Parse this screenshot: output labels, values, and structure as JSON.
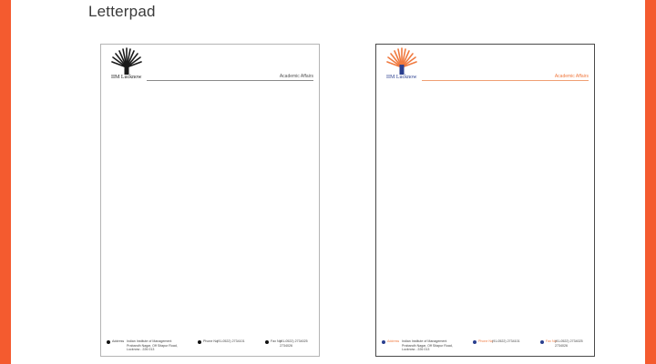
{
  "page": {
    "title": "Letterpad"
  },
  "colors": {
    "accent": "#f45b2f",
    "mono_ink": "#1a1a1a",
    "brand_orange": "#f07a40",
    "brand_blue": "#2a3f8f"
  },
  "letterheads": [
    {
      "variant": "monochrome",
      "logo_text": "IIM Lucknow",
      "logo_icon": "iim-lucknow-tree-logo",
      "department": "Academic Affairs",
      "footer": {
        "address_label": "Address",
        "address": "Indian Institute of Management\nPrabandh Nagar, Off Sitapur Road,\nLucknow - 226 013",
        "phone_label": "Phone No",
        "phone": "(91-0522) 2734101",
        "fax_label": "Fax No",
        "fax": "(91-0522) 2734025\n2734026"
      }
    },
    {
      "variant": "color",
      "logo_text": "IIM Lucknow",
      "logo_icon": "iim-lucknow-tree-logo",
      "department": "Academic Affairs",
      "footer": {
        "address_label": "Address",
        "address": "Indian Institute of Management\nPrabandh Nagar, Off Sitapur Road,\nLucknow - 226 013",
        "phone_label": "Phone No",
        "phone": "(91-0522) 2734101",
        "fax_label": "Fax No",
        "fax": "(91-0522) 2734025\n2734026"
      }
    }
  ]
}
